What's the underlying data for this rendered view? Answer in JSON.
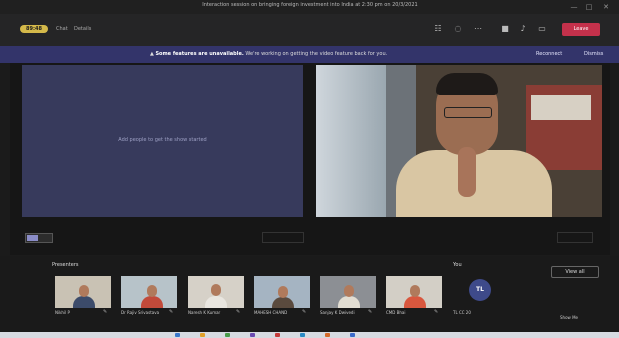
{
  "window": {
    "title": "Interaction session on bringing foreign investment into India at 2:30 pm on 20/3/2021",
    "controls": [
      "—",
      "□",
      "✕"
    ]
  },
  "toolbar": {
    "timer": "89:48",
    "chat_label": "Chat",
    "details_label": "Details",
    "leave_label": "Leave"
  },
  "banner": {
    "title": "Some features are unavailable.",
    "message": "We're working on getting the video feature back for you.",
    "reconnect_label": "Reconnect",
    "dismiss_label": "Dismiss"
  },
  "stage": {
    "share_hint": "Add people to get the show started"
  },
  "gallery": {
    "participants_label": "Presenters",
    "attendees_label": "You",
    "view_all_label": "View all",
    "participants": [
      {
        "name": "Nikhil P"
      },
      {
        "name": "Dr Rajiv Srivastava"
      },
      {
        "name": "Naresh K Kumar"
      },
      {
        "name": "MAHESH CHAND"
      },
      {
        "name": "Sanjay K Dwivedi"
      },
      {
        "name": "CMD Bhai"
      }
    ],
    "self": {
      "initials": "TL",
      "name": "TL CC 20"
    },
    "footer_text": "Show Me"
  },
  "colors": {
    "banner": "#33346a",
    "leave": "#c4314b",
    "timer": "#d4b94a",
    "avatar": "#3e4a8a"
  }
}
